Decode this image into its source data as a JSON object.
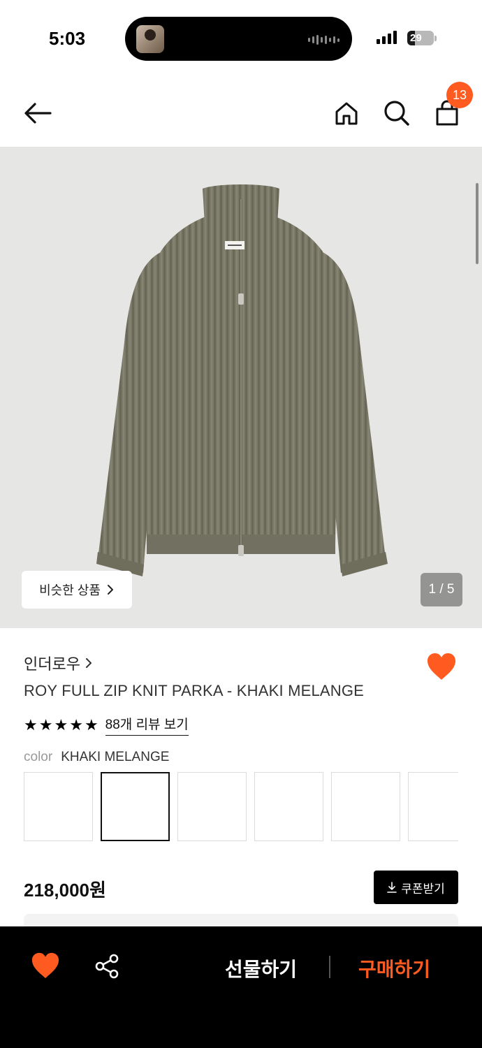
{
  "status_bar": {
    "time": "5:03",
    "battery": "29"
  },
  "nav": {
    "back_icon": "arrow-left-icon",
    "home_icon": "home-icon",
    "search_icon": "search-icon",
    "cart_icon": "shopping-bag-icon",
    "cart_count": "13"
  },
  "gallery": {
    "similar_label": "비슷한 상품",
    "page": "1 / 5"
  },
  "product": {
    "brand": "인더로우",
    "title": "ROY FULL ZIP KNIT PARKA - KHAKI MELANGE",
    "rating_stars": 5,
    "review_link": "88개 리뷰 보기",
    "color_label": "color",
    "color_value": "KHAKI MELANGE",
    "price": "218,000원",
    "coupon_label": "쿠폰받기"
  },
  "bottom_bar": {
    "gift_label": "선물하기",
    "buy_label": "구매하기"
  },
  "colors": {
    "accent": "#ff5a1f",
    "sweater": "#7a7a68",
    "image_bg": "#e6e6e4"
  }
}
